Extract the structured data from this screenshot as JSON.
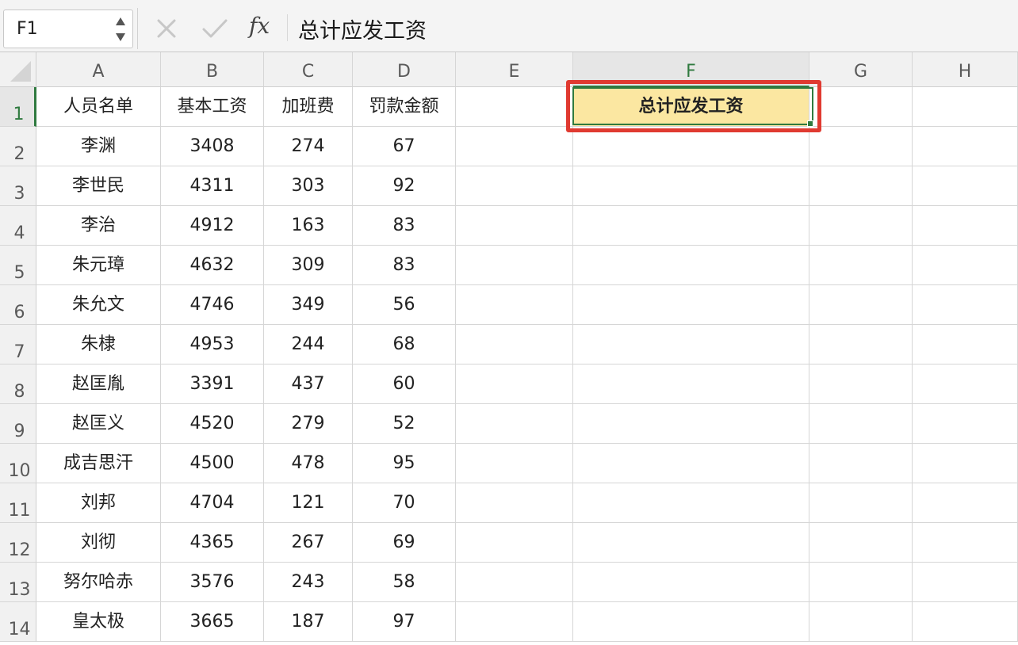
{
  "formula_bar": {
    "name_box": "F1",
    "formula": "总计应发工资"
  },
  "columns": [
    "A",
    "B",
    "C",
    "D",
    "E",
    "F",
    "G",
    "H"
  ],
  "active_column": "F",
  "rows": [
    [
      "人员名单",
      "基本工资",
      "加班费",
      "罚款金额",
      "",
      "总计应发工资",
      "",
      ""
    ],
    [
      "李渊",
      "3408",
      "274",
      "67",
      "",
      "",
      "",
      ""
    ],
    [
      "李世民",
      "4311",
      "303",
      "92",
      "",
      "",
      "",
      ""
    ],
    [
      "李治",
      "4912",
      "163",
      "83",
      "",
      "",
      "",
      ""
    ],
    [
      "朱元璋",
      "4632",
      "309",
      "83",
      "",
      "",
      "",
      ""
    ],
    [
      "朱允文",
      "4746",
      "349",
      "56",
      "",
      "",
      "",
      ""
    ],
    [
      "朱棣",
      "4953",
      "244",
      "68",
      "",
      "",
      "",
      ""
    ],
    [
      "赵匡胤",
      "3391",
      "437",
      "60",
      "",
      "",
      "",
      ""
    ],
    [
      "赵匡义",
      "4520",
      "279",
      "52",
      "",
      "",
      "",
      ""
    ],
    [
      "成吉思汗",
      "4500",
      "478",
      "95",
      "",
      "",
      "",
      ""
    ],
    [
      "刘邦",
      "4704",
      "121",
      "70",
      "",
      "",
      "",
      ""
    ],
    [
      "刘彻",
      "4365",
      "267",
      "69",
      "",
      "",
      "",
      ""
    ],
    [
      "努尔哈赤",
      "3576",
      "243",
      "58",
      "",
      "",
      "",
      ""
    ],
    [
      "皇太极",
      "3665",
      "187",
      "97",
      "",
      "",
      "",
      ""
    ]
  ],
  "row_numbers": [
    "1",
    "2",
    "3",
    "4",
    "5",
    "6",
    "7",
    "8",
    "9",
    "10",
    "11",
    "12",
    "13",
    "14"
  ],
  "colors": {
    "header_highlight": "#fbe7a1",
    "selection_outline": "#e03a31",
    "active_accent": "#2f7a3f"
  },
  "icons": {
    "cancel": "close-icon",
    "confirm": "check-icon",
    "function": "fx-icon"
  }
}
